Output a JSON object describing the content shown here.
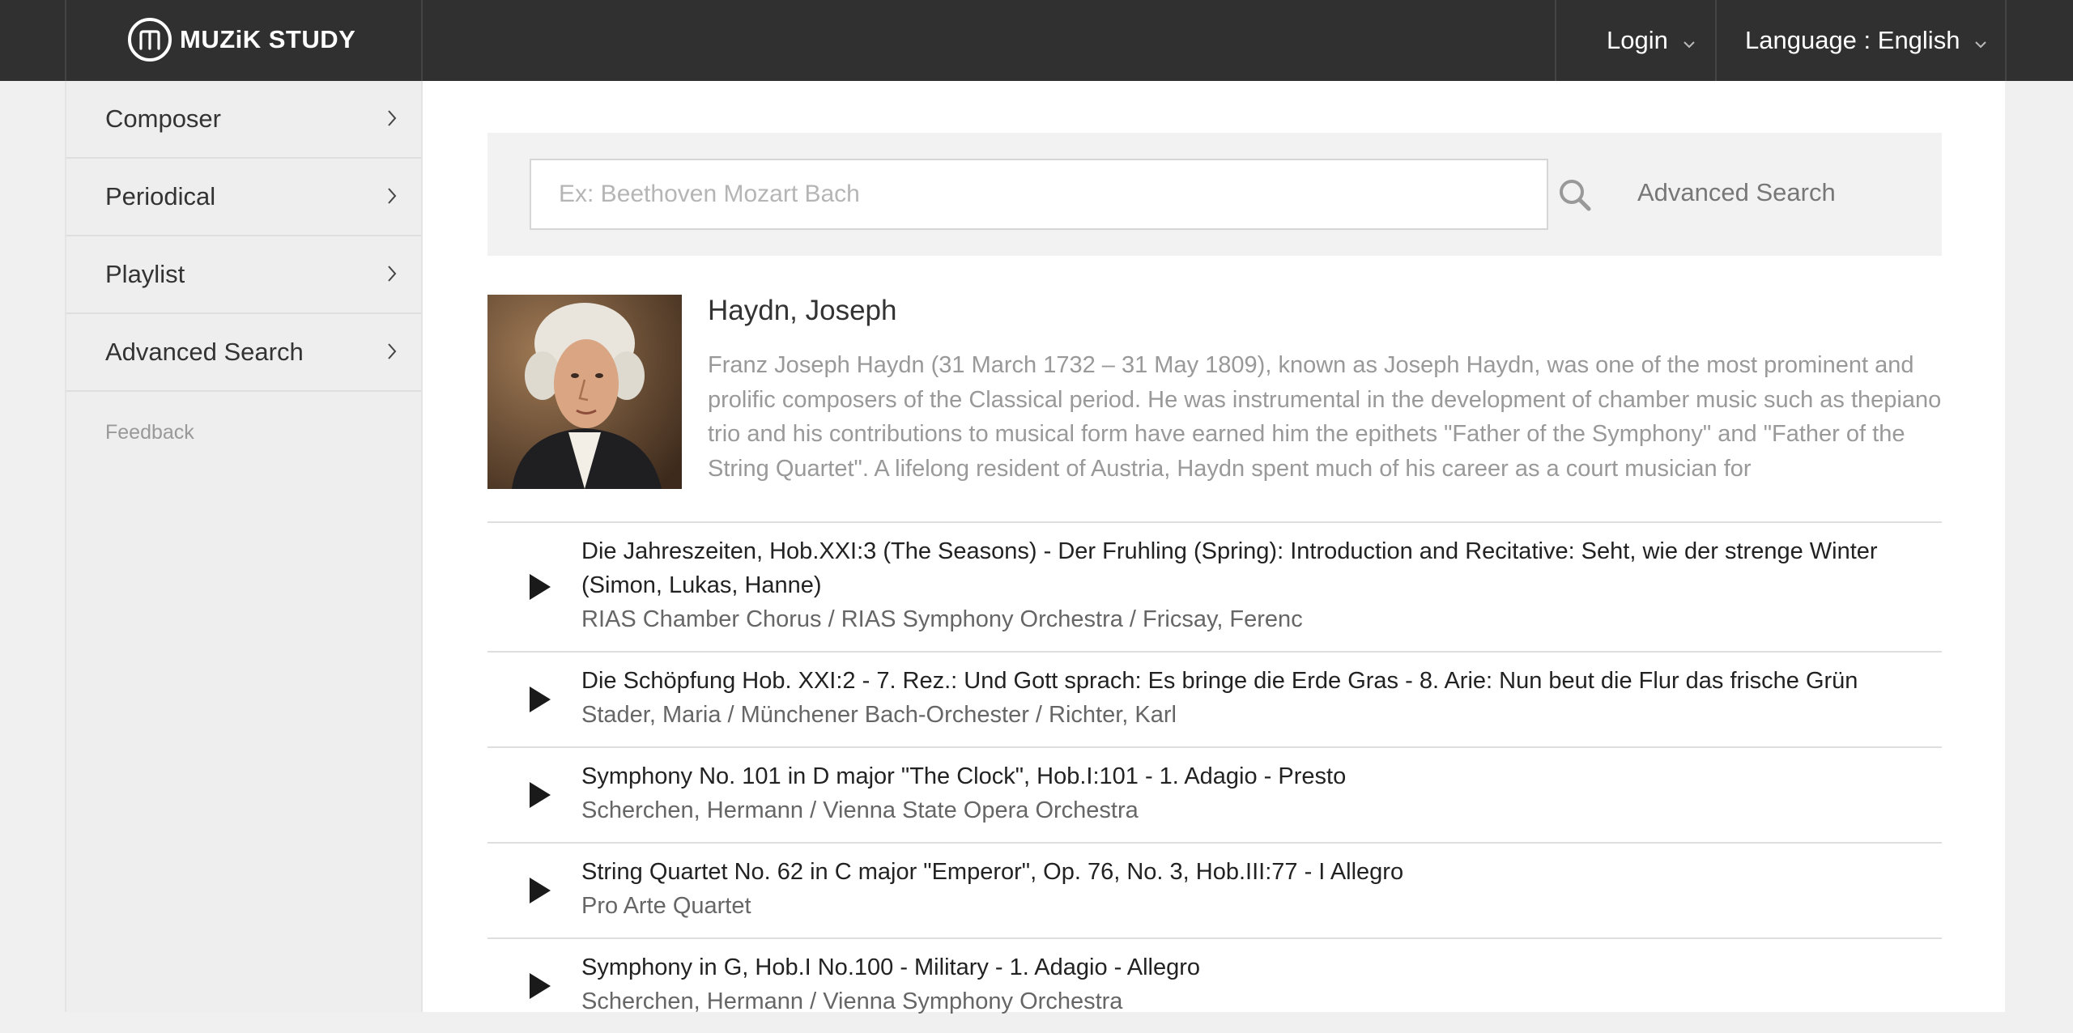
{
  "header": {
    "brand": "MUZiK STUDY",
    "login": "Login",
    "language": "Language : English"
  },
  "sidebar": {
    "items": [
      {
        "label": "Composer"
      },
      {
        "label": "Periodical"
      },
      {
        "label": "Playlist"
      },
      {
        "label": "Advanced Search"
      }
    ],
    "feedback": "Feedback"
  },
  "search": {
    "placeholder": "Ex: Beethoven Mozart Bach",
    "advanced_label": "Advanced Search"
  },
  "composer": {
    "name": "Haydn, Joseph",
    "bio": "Franz Joseph Haydn (31 March 1732 – 31 May 1809), known as Joseph Haydn, was one of the most prominent and prolific composers of the Classical period. He was instrumental in the development of chamber music such as thepiano trio and his contributions to musical form have earned him the epithets \"Father of the Symphony\" and \"Father of the String Quartet\". A lifelong resident of Austria, Haydn spent much of his career as a court musician for"
  },
  "tracks": [
    {
      "title": "Die Jahreszeiten, Hob.XXI:3 (The Seasons) - Der Fruhling (Spring): Introduction and Recitative: Seht, wie der strenge Winter (Simon, Lukas, Hanne)",
      "artist": "RIAS Chamber Chorus / RIAS Symphony Orchestra / Fricsay, Ferenc"
    },
    {
      "title": "Die Schöpfung Hob. XXI:2 - 7. Rez.: Und Gott sprach: Es bringe die Erde Gras - 8. Arie: Nun beut die Flur das frische Grün",
      "artist": "Stader, Maria / Münchener Bach-Orchester / Richter, Karl"
    },
    {
      "title": "Symphony No. 101 in D major \"The Clock\", Hob.I:101 - 1. Adagio - Presto",
      "artist": "Scherchen, Hermann / Vienna State Opera Orchestra"
    },
    {
      "title": "String Quartet No. 62 in C major \"Emperor\", Op. 76, No. 3, Hob.III:77 - I Allegro",
      "artist": "Pro Arte Quartet"
    },
    {
      "title": "Symphony in G, Hob.I No.100 - Military - 1. Adagio - Allegro",
      "artist": "Scherchen, Hermann / Vienna Symphony Orchestra"
    }
  ],
  "icons": {
    "logo": "logo-circle-m-icon",
    "chevron_down": "chevron-down-icon",
    "chevron_right": "chevron-right-icon",
    "search": "search-icon",
    "play": "play-icon"
  },
  "colors": {
    "topbar": "#303030",
    "sidebar": "#eeeeee",
    "muted_text": "#999999"
  }
}
